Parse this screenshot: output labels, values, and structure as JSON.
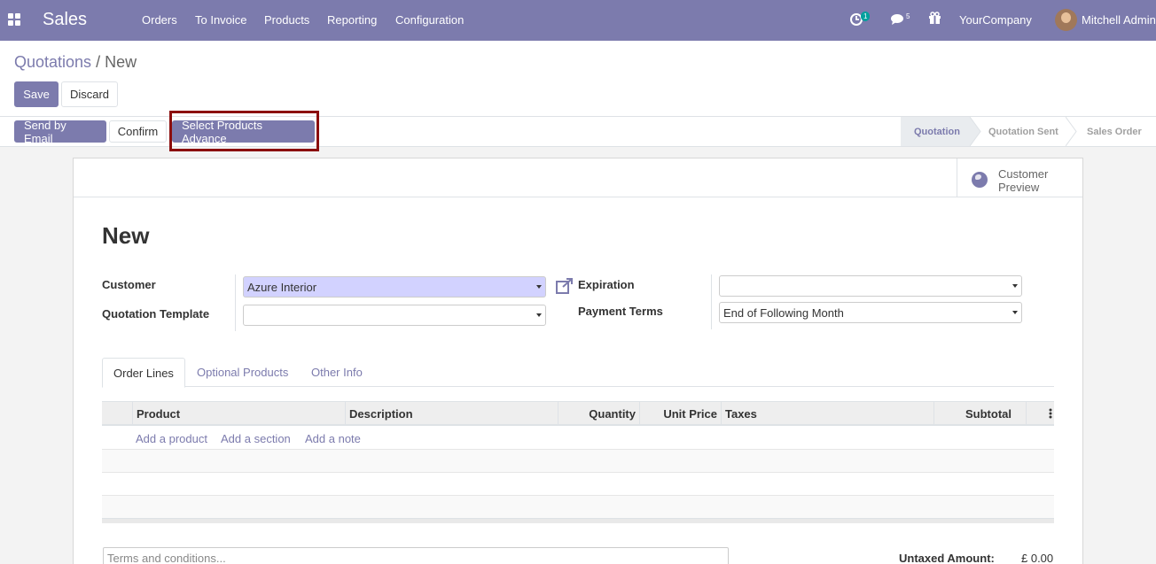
{
  "nav": {
    "app_name": "Sales",
    "menu": [
      "Orders",
      "To Invoice",
      "Products",
      "Reporting",
      "Configuration"
    ],
    "activity_count": "1",
    "message_count": "5",
    "company": "YourCompany",
    "user": "Mitchell Admin"
  },
  "breadcrumb": {
    "parent": "Quotations",
    "separator": "/",
    "current": "New"
  },
  "actions": {
    "save": "Save",
    "discard": "Discard"
  },
  "header_buttons": {
    "send_email": "Send by Email",
    "confirm": "Confirm",
    "select_products": "Select Products Advance"
  },
  "stages": [
    {
      "label": "Quotation",
      "active": true
    },
    {
      "label": "Quotation Sent",
      "active": false
    },
    {
      "label": "Sales Order",
      "active": false
    }
  ],
  "smart_button": {
    "label_line1": "Customer",
    "label_line2": "Preview"
  },
  "form": {
    "title": "New",
    "customer_label": "Customer",
    "customer_value": "Azure Interior",
    "template_label": "Quotation Template",
    "template_value": "",
    "expiration_label": "Expiration",
    "expiration_value": "",
    "payment_terms_label": "Payment Terms",
    "payment_terms_value": "End of Following Month"
  },
  "tabs": [
    "Order Lines",
    "Optional Products",
    "Other Info"
  ],
  "table": {
    "columns": [
      "Product",
      "Description",
      "Quantity",
      "Unit Price",
      "Taxes",
      "Subtotal"
    ],
    "add_product": "Add a product",
    "add_section": "Add a section",
    "add_note": "Add a note"
  },
  "footer": {
    "terms_placeholder": "Terms and conditions...",
    "untaxed_label": "Untaxed Amount:",
    "untaxed_value": "£ 0.00"
  },
  "colors": {
    "brand": "#7c7bad",
    "highlight_border": "#8b0e0e",
    "selected_field": "#d2d2ff"
  }
}
